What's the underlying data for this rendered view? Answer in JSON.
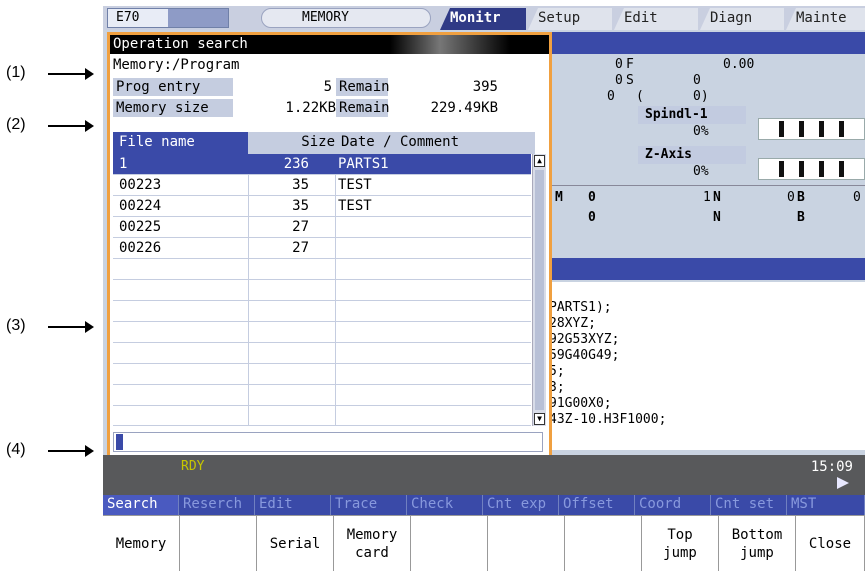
{
  "callouts": [
    "(1)",
    "(2)",
    "(3)",
    "(4)"
  ],
  "topbar": {
    "machine": "E70",
    "mode": "MEMORY",
    "tabs": [
      "Monitr",
      "Setup",
      "Edit",
      "Diagn",
      "Mainte"
    ],
    "active_tab": "Monitr"
  },
  "background": {
    "pos_values": [
      "0",
      "0",
      "0"
    ],
    "f_label": "F",
    "f_value": "0.00",
    "s_label": "S",
    "s_value": "0",
    "paren_open": "(",
    "paren_value": "0)",
    "spindle_label": "Spindl-1",
    "spindle_pct": "0%",
    "zaxis_label": "Z-Axis",
    "zaxis_pct": "0%",
    "m_label": "M",
    "m_value1": "0",
    "m_value2": "0",
    "m_count": "1",
    "n_label": "N",
    "n_value": "0",
    "b_label": "B",
    "b_value": "0",
    "program_lines": [
      "PARTS1);",
      "28XYZ;",
      "92G53XYZ;",
      "59G40G49;",
      "5;",
      "3;",
      "91G00X0;",
      "43Z-10.H3F1000;"
    ]
  },
  "window": {
    "title": "Operation search",
    "path": "Memory:/Program",
    "prog_entry_label": "Prog entry",
    "prog_entry_value": "5",
    "remain_label_1": "Remain",
    "remain_value_1": "395",
    "memory_size_label": "Memory size",
    "memory_size_value": "1.22KB",
    "remain_label_2": "Remain",
    "remain_value_2": "229.49KB",
    "columns": [
      "File name",
      "Size",
      "Date / Comment"
    ],
    "files": [
      {
        "name": "1",
        "size": "236",
        "comment": "PARTS1"
      },
      {
        "name": "00223",
        "size": "35",
        "comment": "TEST"
      },
      {
        "name": "00224",
        "size": "35",
        "comment": "TEST"
      },
      {
        "name": "00225",
        "size": "27",
        "comment": ""
      },
      {
        "name": "00226",
        "size": "27",
        "comment": ""
      }
    ],
    "input_value": ""
  },
  "status": {
    "state": "RDY",
    "time": "15:09"
  },
  "menu": {
    "categories": [
      "Search",
      "Reserch",
      "Edit",
      "Trace",
      "Check",
      "Cnt exp",
      "Offset",
      "Coord",
      "Cnt set",
      "MST"
    ],
    "active_category": "Search",
    "keys": [
      "Memory",
      "",
      "Serial",
      "Memory\ncard",
      "",
      "",
      "",
      "Top\njump",
      "Bottom\njump",
      "Close"
    ]
  }
}
